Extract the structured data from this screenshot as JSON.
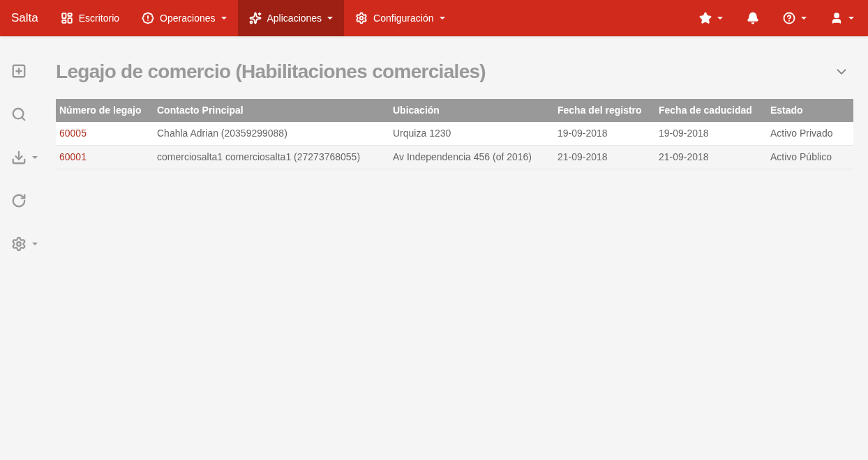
{
  "navbar": {
    "brand": "Salta",
    "items": [
      {
        "label": "Escritorio",
        "dropdown": false,
        "selected": false
      },
      {
        "label": "Operaciones",
        "dropdown": true,
        "selected": false
      },
      {
        "label": "Aplicaciones",
        "dropdown": true,
        "selected": true
      },
      {
        "label": "Configuración",
        "dropdown": true,
        "selected": false
      }
    ],
    "right": [
      {
        "dropdown": true
      },
      {
        "dropdown": false
      },
      {
        "dropdown": true
      },
      {
        "dropdown": true
      }
    ]
  },
  "toolbar": [
    {
      "dropdown": false
    },
    {
      "dropdown": false
    },
    {
      "dropdown": true
    },
    {
      "dropdown": false
    },
    {
      "dropdown": true
    }
  ],
  "page": {
    "title": "Legajo de comercio (Habilitaciones comerciales)"
  },
  "table": {
    "columns": [
      "Número de legajo",
      "Contacto Principal",
      "Ubicación",
      "Fecha del registro",
      "Fecha de caducidad",
      "Estado"
    ],
    "rows": [
      [
        "60005",
        "Chahla Adrian (20359299088)",
        "Urquiza 1230",
        "19-09-2018",
        "19-09-2018",
        "Activo Privado"
      ],
      [
        "60001",
        "comerciosalta1 comerciosalta1 (27273768055)",
        "Av Independencia 456 (of 2016)",
        "21-09-2018",
        "21-09-2018",
        "Activo Público"
      ]
    ]
  }
}
